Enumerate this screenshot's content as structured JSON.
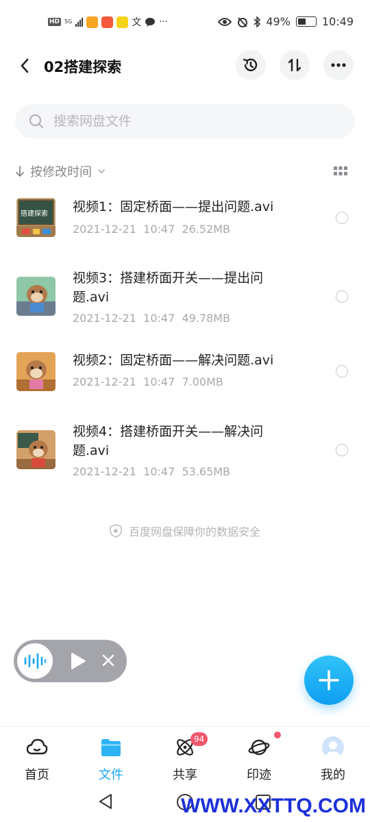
{
  "status_bar": {
    "left_hd": "HD",
    "left_net": "5G",
    "left_more": "···",
    "battery": "49%",
    "battery_level": 0.49,
    "time": "10:49"
  },
  "header": {
    "title": "02搭建探索",
    "back_icon": "chevron-left-icon",
    "history_icon": "history-icon",
    "sort_icon": "sort-arrows-icon",
    "more_icon": "more-horizontal-icon"
  },
  "search": {
    "placeholder": "搜索网盘文件"
  },
  "sort": {
    "label": "按修改时间"
  },
  "files": [
    {
      "name": "视频1：固定桥面——提出问题.avi",
      "date": "2021-12-21  10:47",
      "size": "26.52MB"
    },
    {
      "name": "视频3：搭建桥面开关——提出问题.avi",
      "date": "2021-12-21  10:47",
      "size": "49.78MB"
    },
    {
      "name": "视频2：固定桥面——解决问题.avi",
      "date": "2021-12-21  10:47",
      "size": "7.00MB"
    },
    {
      "name": "视频4：搭建桥面开关——解决问题.avi",
      "date": "2021-12-21  10:47",
      "size": "53.65MB"
    }
  ],
  "thumb_text": "搭建探索",
  "safety_text": "百度网盘保障你的数据安全",
  "tabs": [
    {
      "label": "首页",
      "icon": "cloud-icon"
    },
    {
      "label": "文件",
      "icon": "folder-icon"
    },
    {
      "label": "共享",
      "icon": "atom-icon",
      "badge": "94"
    },
    {
      "label": "印迹",
      "icon": "planet-icon"
    },
    {
      "label": "我的",
      "icon": "avatar-icon"
    }
  ],
  "watermark": "WWW.XXTTQ.COM",
  "colors": {
    "accent": "#1aa6f0",
    "badge": "#f2566b",
    "fab": "#0d9ef2"
  }
}
